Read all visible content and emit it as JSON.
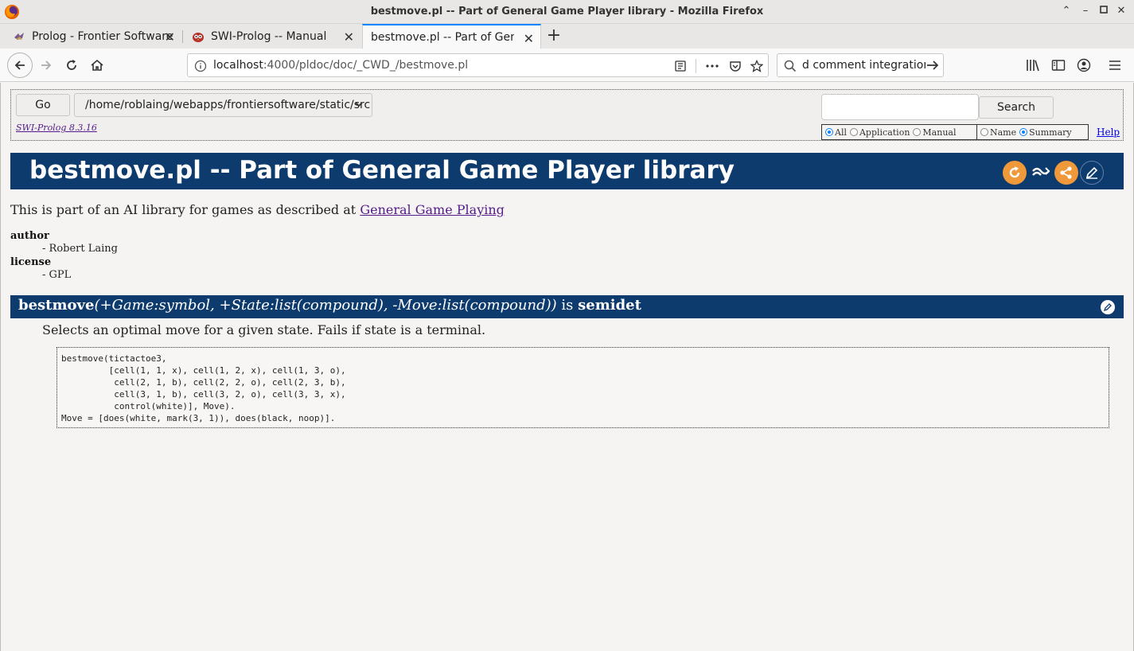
{
  "window": {
    "title": "bestmove.pl -- Part of General Game Player library - Mozilla Firefox"
  },
  "tabs": [
    {
      "label": "Prolog - Frontier Software",
      "icon": "frontier-favicon-icon",
      "active": false
    },
    {
      "label": "SWI-Prolog -- Manual",
      "icon": "swi-owl-icon",
      "active": false
    },
    {
      "label": "bestmove.pl -- Part of Gener",
      "icon": "none",
      "active": true
    }
  ],
  "navbar": {
    "url_host": "localhost",
    "url_path": ":4000/pldoc/doc/_CWD_/bestmove.pl",
    "search_text": "d comment integration"
  },
  "pldoc_nav": {
    "go_label": "Go",
    "directory": "/home/roblaing/webapps/frontiersoftware/static/src",
    "version_link": "SWI-Prolog 8.3.16",
    "search_label": "Search",
    "search_value": "",
    "scope_options": [
      {
        "label": "All",
        "checked": true
      },
      {
        "label": "Application",
        "checked": false
      },
      {
        "label": "Manual",
        "checked": false
      }
    ],
    "field_options": [
      {
        "label": "Name",
        "checked": false
      },
      {
        "label": "Summary",
        "checked": true
      }
    ],
    "help_label": "Help"
  },
  "file": {
    "title": "bestmove.pl -- Part of General Game Player library",
    "intro_text": "This is part of an AI library for games as described at ",
    "intro_link": "General Game Playing",
    "tags": [
      {
        "label": "author",
        "value": "- Robert Laing"
      },
      {
        "label": "license",
        "value": "- GPL"
      }
    ]
  },
  "predicate": {
    "name": "bestmove",
    "args": "(+Game:symbol, +State:list(compound), -Move:list(compound))",
    "is_text": " is ",
    "determinism": "semidet",
    "description": "Selects an optimal move for a given state. Fails if state is a terminal.",
    "example": "bestmove(tictactoe3,\n         [cell(1, 1, x), cell(1, 2, x), cell(1, 3, o),\n          cell(2, 1, b), cell(2, 2, o), cell(2, 3, b),\n          cell(3, 1, b), cell(3, 2, o), cell(3, 3, x),\n          control(white)], Move).\nMove = [does(white, mark(3, 1)), does(black, noop)]."
  },
  "colors": {
    "header_bg": "#0e3b6e",
    "orange_icon": "#f0993a",
    "link_visited": "#551a8b",
    "tab_accent": "#0a84ff"
  }
}
